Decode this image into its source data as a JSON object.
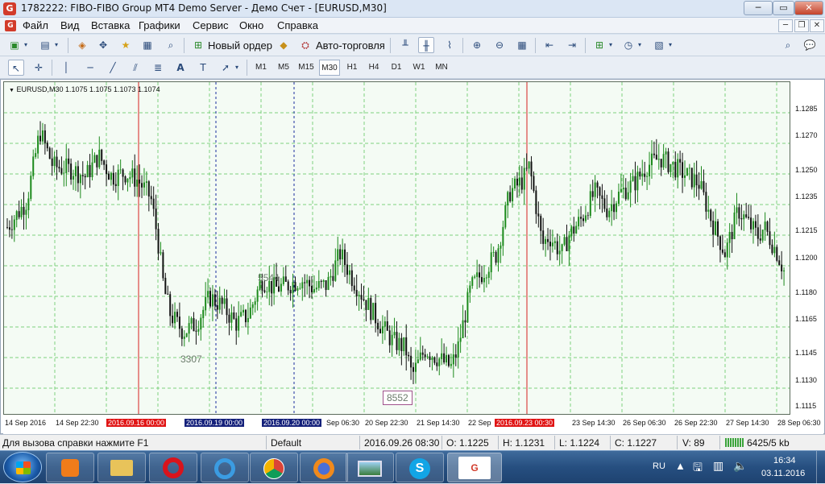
{
  "window": {
    "title": "1782222: FIBO-FIBO Group MT4 Demo Server - Демо Счет - [EURUSD,M30]",
    "app_icon": "G"
  },
  "menu": [
    "Файл",
    "Вид",
    "Вставка",
    "Графики",
    "Сервис",
    "Окно",
    "Справка"
  ],
  "toolbar": {
    "new_order": "Новый ордер",
    "autotrade": "Авто-торговля"
  },
  "timeframes": {
    "items": [
      "M1",
      "M5",
      "M15",
      "M30",
      "H1",
      "H4",
      "D1",
      "W1",
      "MN"
    ],
    "active": "M30"
  },
  "chart": {
    "header": "EURUSD,M30  1.1075 1.1075 1.1073 1.1074",
    "price_labels": [
      "1.1285",
      "1.1270",
      "1.1250",
      "1.1235",
      "1.1215",
      "1.1200",
      "1.1180",
      "1.1165",
      "1.1145",
      "1.1130",
      "1.1115"
    ],
    "time_labels": [
      {
        "text": "14 Sep 2016",
        "style": "plain"
      },
      {
        "text": "14 Sep 22:30",
        "style": "plain"
      },
      {
        "text": "2016.09.16 00:00",
        "style": "red"
      },
      {
        "text": "2016.09.19 00:00",
        "style": "navy"
      },
      {
        "text": "2016.09.20 00:00",
        "style": "navy"
      },
      {
        "text": "Sep 06:30",
        "style": "plain"
      },
      {
        "text": "20 Sep 22:30",
        "style": "plain"
      },
      {
        "text": "21 Sep 14:30",
        "style": "plain"
      },
      {
        "text": "22 Sep",
        "style": "plain"
      },
      {
        "text": "2016.09.23 00:30",
        "style": "red"
      },
      {
        "text": "23 Sep 14:30",
        "style": "plain"
      },
      {
        "text": "26 Sep 06:30",
        "style": "plain"
      },
      {
        "text": "26 Sep 22:30",
        "style": "plain"
      },
      {
        "text": "27 Sep 14:30",
        "style": "plain"
      },
      {
        "text": "28 Sep 06:30",
        "style": "plain"
      }
    ],
    "annotations": [
      "5544",
      "3307",
      "8552"
    ]
  },
  "chart_data": {
    "type": "ohlc",
    "symbol": "EURUSD",
    "timeframe": "M30",
    "ylim": [
      1.1108,
      1.1298
    ],
    "grid": true,
    "title": "EURUSD,M30",
    "close_path": [
      [
        0,
        1.1215
      ],
      [
        3,
        1.123
      ],
      [
        5,
        1.127
      ],
      [
        7,
        1.125
      ],
      [
        10,
        1.1248
      ],
      [
        12,
        1.1244
      ],
      [
        14,
        1.1256
      ],
      [
        16,
        1.1244
      ],
      [
        18,
        1.1246
      ],
      [
        20,
        1.1242
      ],
      [
        22,
        1.1232
      ],
      [
        23,
        1.121
      ],
      [
        24,
        1.118
      ],
      [
        25,
        1.1165
      ],
      [
        27,
        1.1155
      ],
      [
        29,
        1.116
      ],
      [
        31,
        1.1175
      ],
      [
        33,
        1.117
      ],
      [
        35,
        1.116
      ],
      [
        37,
        1.1165
      ],
      [
        39,
        1.1185
      ],
      [
        41,
        1.118
      ],
      [
        43,
        1.1182
      ],
      [
        45,
        1.1185
      ],
      [
        47,
        1.118
      ],
      [
        49,
        1.1182
      ],
      [
        51,
        1.12
      ],
      [
        53,
        1.1185
      ],
      [
        55,
        1.1172
      ],
      [
        57,
        1.116
      ],
      [
        59,
        1.115
      ],
      [
        61,
        1.1146
      ],
      [
        62,
        1.113
      ],
      [
        64,
        1.1145
      ],
      [
        66,
        1.114
      ],
      [
        68,
        1.1135
      ],
      [
        69,
        1.1145
      ],
      [
        71,
        1.118
      ],
      [
        73,
        1.119
      ],
      [
        75,
        1.12
      ],
      [
        77,
        1.1235
      ],
      [
        79,
        1.1242
      ],
      [
        80,
        1.125
      ],
      [
        82,
        1.1205
      ],
      [
        83,
        1.121
      ],
      [
        85,
        1.12
      ],
      [
        86,
        1.121
      ],
      [
        88,
        1.122
      ],
      [
        90,
        1.1235
      ],
      [
        92,
        1.1225
      ],
      [
        94,
        1.1235
      ],
      [
        96,
        1.124
      ],
      [
        98,
        1.125
      ],
      [
        100,
        1.1255
      ],
      [
        102,
        1.125
      ],
      [
        104,
        1.1245
      ],
      [
        106,
        1.124
      ],
      [
        108,
        1.1218
      ],
      [
        110,
        1.12
      ],
      [
        112,
        1.1225
      ],
      [
        113,
        1.122
      ],
      [
        115,
        1.121
      ],
      [
        116,
        1.1215
      ],
      [
        118,
        1.12
      ],
      [
        119,
        1.119
      ]
    ],
    "vlines": [
      {
        "at": "2016.09.16 00:00",
        "color": "red",
        "style": "solid"
      },
      {
        "at": "2016.09.19 00:00",
        "color": "navy",
        "style": "dotted"
      },
      {
        "at": "2016.09.20 00:00",
        "color": "navy",
        "style": "dotted"
      },
      {
        "at": "2016.09.23 00:30",
        "color": "red",
        "style": "solid"
      }
    ]
  },
  "status": {
    "help": "Для вызова справки нажмите F1",
    "profile": "Default",
    "datetime": "2016.09.26 08:30",
    "open": "O: 1.1225",
    "high": "H: 1.1231",
    "low": "L: 1.1224",
    "close": "C: 1.1227",
    "volume": "V: 89",
    "traffic": "6425/5 kb"
  },
  "taskbar": {
    "lang": "RU",
    "time": "16:34",
    "date": "03.11.2016"
  }
}
